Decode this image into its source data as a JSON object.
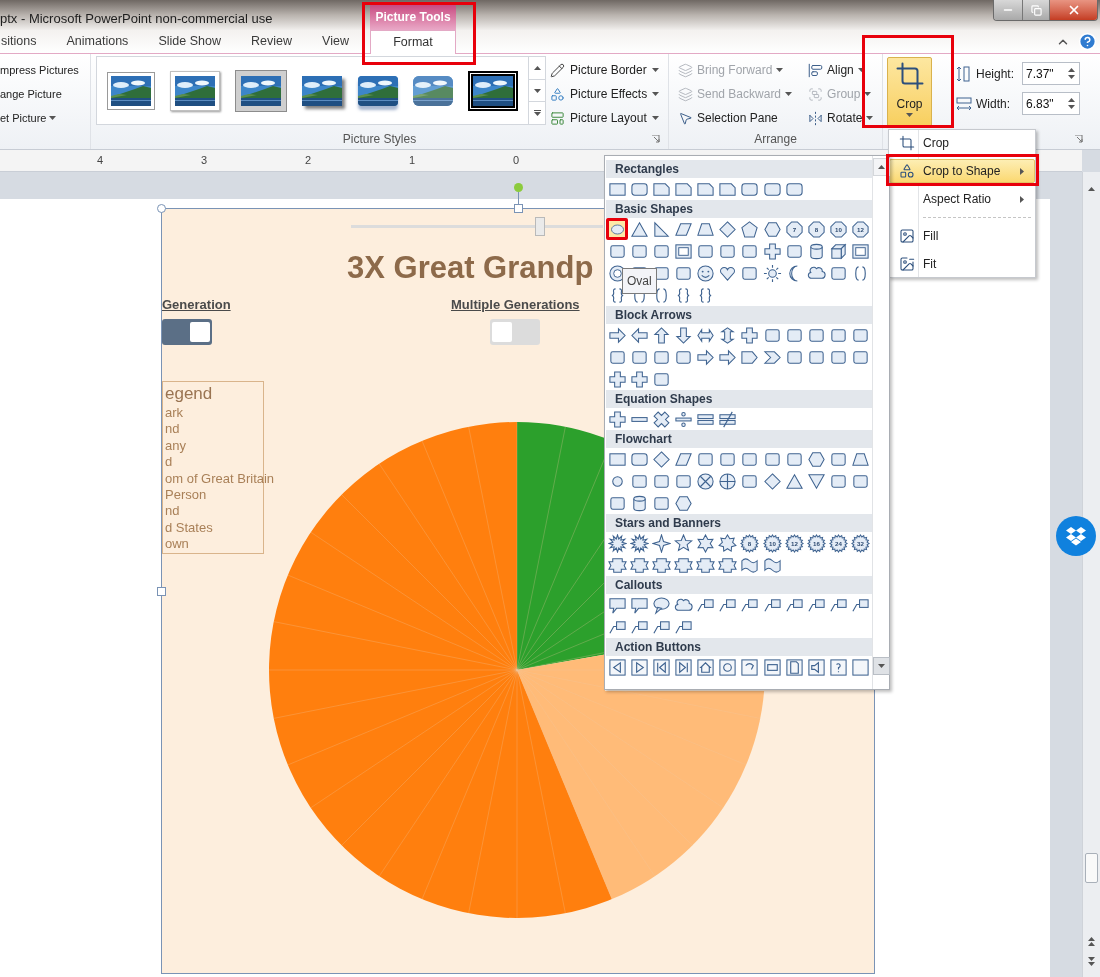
{
  "window": {
    "title": "ptx - Microsoft PowerPoint non-commercial use",
    "contextual_group": "Picture Tools"
  },
  "tabs": [
    {
      "label": "sitions",
      "selected": false
    },
    {
      "label": "Animations",
      "selected": false
    },
    {
      "label": "Slide Show",
      "selected": false
    },
    {
      "label": "Review",
      "selected": false
    },
    {
      "label": "View",
      "selected": false
    },
    {
      "label": "Format",
      "selected": true
    }
  ],
  "ribbon": {
    "adjust": {
      "items": [
        {
          "label": "mpress Pictures",
          "dropdown": false
        },
        {
          "label": "ange Picture",
          "dropdown": false
        },
        {
          "label": "et Picture",
          "dropdown": true
        }
      ]
    },
    "picture_styles": {
      "label": "Picture Styles",
      "thumbnails": [
        {
          "kind": "thin-frame"
        },
        {
          "kind": "white-frame"
        },
        {
          "kind": "beveled-frame"
        },
        {
          "kind": "shadow"
        },
        {
          "kind": "reflection"
        },
        {
          "kind": "soft-edge"
        },
        {
          "kind": "black-frame"
        }
      ],
      "buttons": [
        {
          "kind": "border",
          "label": "Picture Border"
        },
        {
          "kind": "effects",
          "label": "Picture Effects"
        },
        {
          "kind": "layout",
          "label": "Picture Layout"
        }
      ]
    },
    "arrange": {
      "label": "Arrange",
      "buttons": [
        {
          "kind": "forward",
          "label": "Bring Forward",
          "disabled": true,
          "dropdown": true
        },
        {
          "kind": "backward",
          "label": "Send Backward",
          "disabled": true,
          "dropdown": true
        },
        {
          "kind": "selection",
          "label": "Selection Pane",
          "disabled": false,
          "dropdown": false
        },
        {
          "kind": "align",
          "label": "Align",
          "disabled": false,
          "dropdown": true
        },
        {
          "kind": "group",
          "label": "Group",
          "disabled": true,
          "dropdown": true
        },
        {
          "kind": "rotate",
          "label": "Rotate",
          "disabled": false,
          "dropdown": true
        }
      ]
    },
    "size": {
      "crop": {
        "label": "Crop",
        "pressed": true
      },
      "fields": [
        {
          "kind": "height",
          "label": "Height:",
          "value": "7.37\""
        },
        {
          "kind": "width",
          "label": "Width:",
          "value": "6.83\""
        }
      ]
    }
  },
  "ruler": {
    "numbers": [
      "4",
      "3",
      "2",
      "1",
      "0"
    ]
  },
  "slide": {
    "slider": {
      "level": 0.75
    },
    "title": "3X Great Grandp",
    "toggles": [
      {
        "label": "Generation",
        "on": true
      },
      {
        "label": "Multiple Generations",
        "on": false
      }
    ],
    "legend": {
      "title": "egend",
      "items": [
        "ark",
        "nd",
        "any",
        "d",
        "om of Great Britain",
        "Person",
        "nd",
        "d States",
        "own"
      ]
    }
  },
  "crop_menu": {
    "items": [
      {
        "kind": "command",
        "label": "Crop",
        "selected": false
      },
      {
        "kind": "submenu",
        "label": "Crop to Shape",
        "selected": true
      },
      {
        "kind": "submenu",
        "label": "Aspect Ratio",
        "selected": false
      },
      {
        "kind": "separator"
      },
      {
        "kind": "command",
        "label": "Fill",
        "selected": false
      },
      {
        "kind": "command",
        "label": "Fit",
        "selected": false
      }
    ]
  },
  "shape_gallery": {
    "tooltip": "Oval",
    "categories": [
      {
        "name": "Rectangles",
        "shapes": [
          {
            "kind": "rect"
          },
          {
            "kind": "round-rect"
          },
          {
            "kind": "snip-rect"
          },
          {
            "kind": "snip-rect"
          },
          {
            "kind": "snip-rect"
          },
          {
            "kind": "snip-rect"
          },
          {
            "kind": "round-rect"
          },
          {
            "kind": "round-rect"
          },
          {
            "kind": "round-rect"
          }
        ]
      },
      {
        "name": "Basic Shapes",
        "shapes": [
          {
            "kind": "oval",
            "hovered": true
          },
          {
            "kind": "triangle"
          },
          {
            "kind": "right-triangle"
          },
          {
            "kind": "parallelogram"
          },
          {
            "kind": "trapezoid"
          },
          {
            "kind": "diamond"
          },
          {
            "kind": "pentagon"
          },
          {
            "kind": "hexagon"
          },
          {
            "kind": "octagon",
            "label": "7"
          },
          {
            "kind": "octagon",
            "label": "8"
          },
          {
            "kind": "octagon",
            "label": "10"
          },
          {
            "kind": "octagon",
            "label": "12"
          },
          {
            "kind": "shape"
          },
          {
            "kind": "shape"
          },
          {
            "kind": "shape"
          },
          {
            "kind": "frame"
          },
          {
            "kind": "shape"
          },
          {
            "kind": "shape"
          },
          {
            "kind": "shape"
          },
          {
            "kind": "plus"
          },
          {
            "kind": "shape"
          },
          {
            "kind": "can"
          },
          {
            "kind": "cube"
          },
          {
            "kind": "frame"
          },
          {
            "kind": "donut"
          },
          {
            "kind": "shape"
          },
          {
            "kind": "shape"
          },
          {
            "kind": "shape"
          },
          {
            "kind": "smiley"
          },
          {
            "kind": "heart"
          },
          {
            "kind": "shape"
          },
          {
            "kind": "sun"
          },
          {
            "kind": "moon"
          },
          {
            "kind": "cloud"
          },
          {
            "kind": "shape"
          },
          {
            "kind": "bracket"
          },
          {
            "kind": "brace"
          },
          {
            "kind": "bracket"
          },
          {
            "kind": "bracket"
          },
          {
            "kind": "brace"
          },
          {
            "kind": "brace"
          }
        ]
      },
      {
        "name": "Block Arrows",
        "shapes": [
          {
            "kind": "arrow-right"
          },
          {
            "kind": "arrow-left"
          },
          {
            "kind": "arrow-up"
          },
          {
            "kind": "arrow-down"
          },
          {
            "kind": "arrow-left-right"
          },
          {
            "kind": "arrow-up-down"
          },
          {
            "kind": "plus"
          },
          {
            "kind": "shape"
          },
          {
            "kind": "shape"
          },
          {
            "kind": "shape"
          },
          {
            "kind": "shape"
          },
          {
            "kind": "shape"
          },
          {
            "kind": "shape"
          },
          {
            "kind": "shape"
          },
          {
            "kind": "shape"
          },
          {
            "kind": "shape"
          },
          {
            "kind": "arrow-right"
          },
          {
            "kind": "arrow-right"
          },
          {
            "kind": "pentagon-arrow"
          },
          {
            "kind": "chevron"
          },
          {
            "kind": "shape"
          },
          {
            "kind": "shape"
          },
          {
            "kind": "shape"
          },
          {
            "kind": "shape"
          },
          {
            "kind": "plus"
          },
          {
            "kind": "plus"
          },
          {
            "kind": "shape"
          }
        ]
      },
      {
        "name": "Equation Shapes",
        "shapes": [
          {
            "kind": "plus"
          },
          {
            "kind": "minus"
          },
          {
            "kind": "times"
          },
          {
            "kind": "divide"
          },
          {
            "kind": "equal"
          },
          {
            "kind": "not-equal"
          }
        ]
      },
      {
        "name": "Flowchart",
        "shapes": [
          {
            "kind": "rect"
          },
          {
            "kind": "round-rect"
          },
          {
            "kind": "diamond"
          },
          {
            "kind": "parallelogram"
          },
          {
            "kind": "shape"
          },
          {
            "kind": "shape"
          },
          {
            "kind": "shape"
          },
          {
            "kind": "shape"
          },
          {
            "kind": "shape"
          },
          {
            "kind": "hexagon"
          },
          {
            "kind": "shape"
          },
          {
            "kind": "trapezoid"
          },
          {
            "kind": "circle"
          },
          {
            "kind": "shape"
          },
          {
            "kind": "shape"
          },
          {
            "kind": "shape"
          },
          {
            "kind": "circle-x"
          },
          {
            "kind": "circle-plus"
          },
          {
            "kind": "shape"
          },
          {
            "kind": "diamond"
          },
          {
            "kind": "triangle"
          },
          {
            "kind": "triangle-down"
          },
          {
            "kind": "shape"
          },
          {
            "kind": "shape"
          },
          {
            "kind": "shape"
          },
          {
            "kind": "can"
          },
          {
            "kind": "shape"
          },
          {
            "kind": "hexagon"
          }
        ]
      },
      {
        "name": "Stars and Banners",
        "shapes": [
          {
            "kind": "burst"
          },
          {
            "kind": "burst"
          },
          {
            "kind": "star4"
          },
          {
            "kind": "star"
          },
          {
            "kind": "star6"
          },
          {
            "kind": "star7"
          },
          {
            "kind": "seal",
            "label": "8"
          },
          {
            "kind": "seal",
            "label": "10"
          },
          {
            "kind": "seal",
            "label": "12"
          },
          {
            "kind": "seal",
            "label": "16"
          },
          {
            "kind": "seal",
            "label": "24"
          },
          {
            "kind": "seal",
            "label": "32"
          },
          {
            "kind": "banner"
          },
          {
            "kind": "banner"
          },
          {
            "kind": "banner"
          },
          {
            "kind": "banner"
          },
          {
            "kind": "banner"
          },
          {
            "kind": "banner"
          },
          {
            "kind": "wave"
          },
          {
            "kind": "wave"
          }
        ]
      },
      {
        "name": "Callouts",
        "shapes": [
          {
            "kind": "callout"
          },
          {
            "kind": "callout"
          },
          {
            "kind": "speech-oval"
          },
          {
            "kind": "cloud"
          },
          {
            "kind": "line-callout"
          },
          {
            "kind": "line-callout"
          },
          {
            "kind": "line-callout"
          },
          {
            "kind": "line-callout"
          },
          {
            "kind": "line-callout"
          },
          {
            "kind": "line-callout"
          },
          {
            "kind": "line-callout"
          },
          {
            "kind": "line-callout"
          },
          {
            "kind": "line-callout"
          },
          {
            "kind": "line-callout"
          },
          {
            "kind": "line-callout"
          },
          {
            "kind": "line-callout"
          }
        ]
      },
      {
        "name": "Action Buttons",
        "shapes": [
          {
            "kind": "back-button"
          },
          {
            "kind": "forward-button"
          },
          {
            "kind": "start-button"
          },
          {
            "kind": "end-button"
          },
          {
            "kind": "home-button"
          },
          {
            "kind": "info-button"
          },
          {
            "kind": "return-button"
          },
          {
            "kind": "movie-button"
          },
          {
            "kind": "document-button"
          },
          {
            "kind": "sound-button"
          },
          {
            "kind": "help-button"
          },
          {
            "kind": "blank-button"
          }
        ]
      }
    ]
  }
}
